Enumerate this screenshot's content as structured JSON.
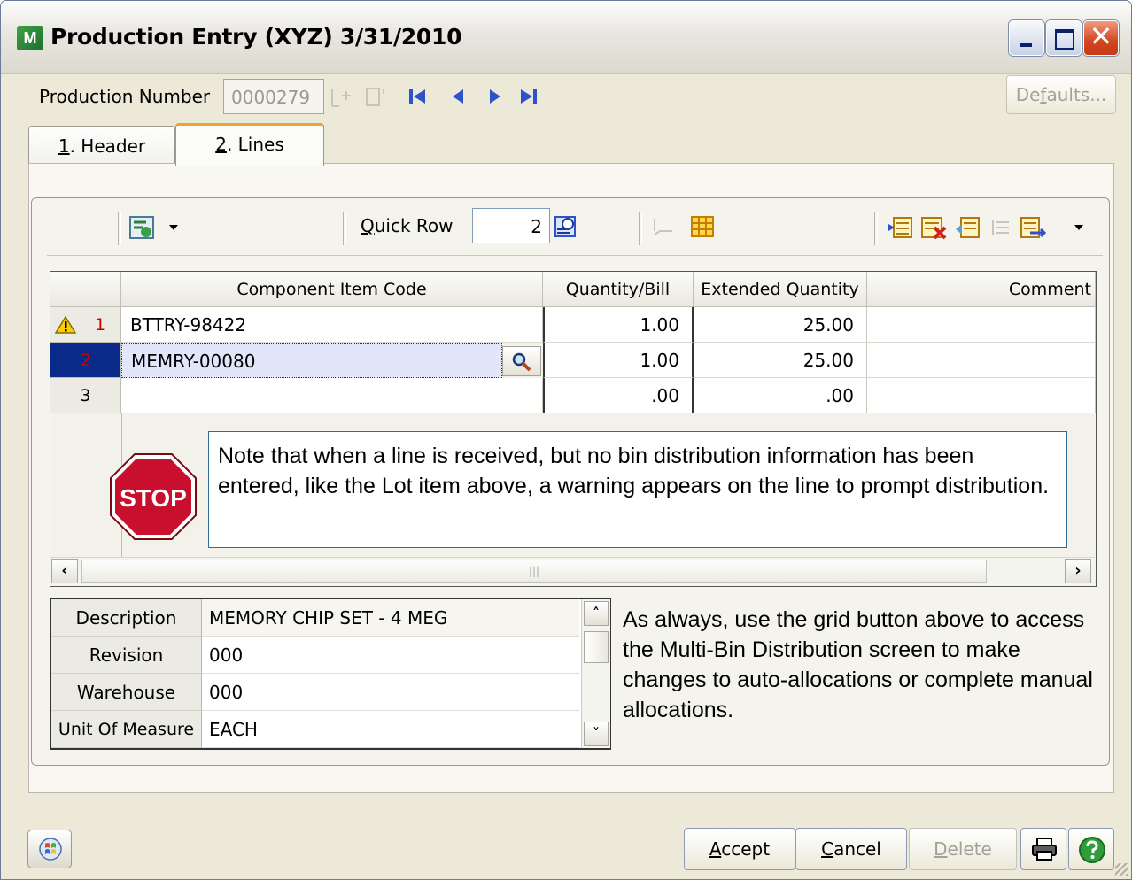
{
  "window": {
    "title": "Production Entry (XYZ) 3/31/2010",
    "icon": "app-icon",
    "app_icon_text": "M",
    "close_glyph": "✕"
  },
  "header": {
    "production_number_label": "Production Number",
    "production_number_value": "0000279",
    "defaults_button": {
      "before": "De",
      "accel": "f",
      "after": "aults..."
    }
  },
  "tabs": [
    {
      "accel": "1",
      "rest": ". Header",
      "active": false
    },
    {
      "accel": "2",
      "rest": ". Lines",
      "active": true
    }
  ],
  "toolbar": {
    "quick_row_label": {
      "accel": "Q",
      "rest": "uick Row"
    },
    "quick_row_value": "2"
  },
  "grid": {
    "columns": [
      "Component Item Code",
      "Quantity/Bill",
      "Extended Quantity",
      "Comment"
    ],
    "rows": [
      {
        "num": "1",
        "warning": true,
        "item_code": "BTTRY-98422",
        "qty_bill": "1.00",
        "ext_qty": "25.00",
        "comment": ""
      },
      {
        "num": "2",
        "selected": true,
        "item_code": "MEMRY-00080",
        "qty_bill": "1.00",
        "ext_qty": "25.00",
        "comment": ""
      },
      {
        "num": "3",
        "item_code": "",
        "qty_bill": ".00",
        "ext_qty": ".00",
        "comment": ""
      }
    ],
    "scroll_thumb_glyph": "|||"
  },
  "callout_text": "Note that when a line is received, but no bin distribution information has been entered, like the Lot item above, a warning appears on the line to prompt distribution.",
  "stop_sign_text": "STOP",
  "properties": [
    {
      "label": "Description",
      "value": "MEMORY CHIP SET - 4 MEG"
    },
    {
      "label": "Revision",
      "value": "000"
    },
    {
      "label": "Warehouse",
      "value": "000"
    },
    {
      "label": "Unit Of Measure",
      "value": "EACH"
    }
  ],
  "side_note": "As always, use the grid button above to access the Multi-Bin Distribution screen to make changes to auto-allocations or complete manual allocations.",
  "footer": {
    "accept": {
      "accel": "A",
      "rest": "ccept"
    },
    "cancel": {
      "accel": "C",
      "rest": "ancel"
    },
    "delete": {
      "accel": "D",
      "rest": "elete"
    }
  },
  "colors": {
    "selected_row_header": "#0a2a8a",
    "row_number_red": "#cc0000",
    "stop_red": "#c8102e",
    "nav_blue": "#2e52c9"
  }
}
